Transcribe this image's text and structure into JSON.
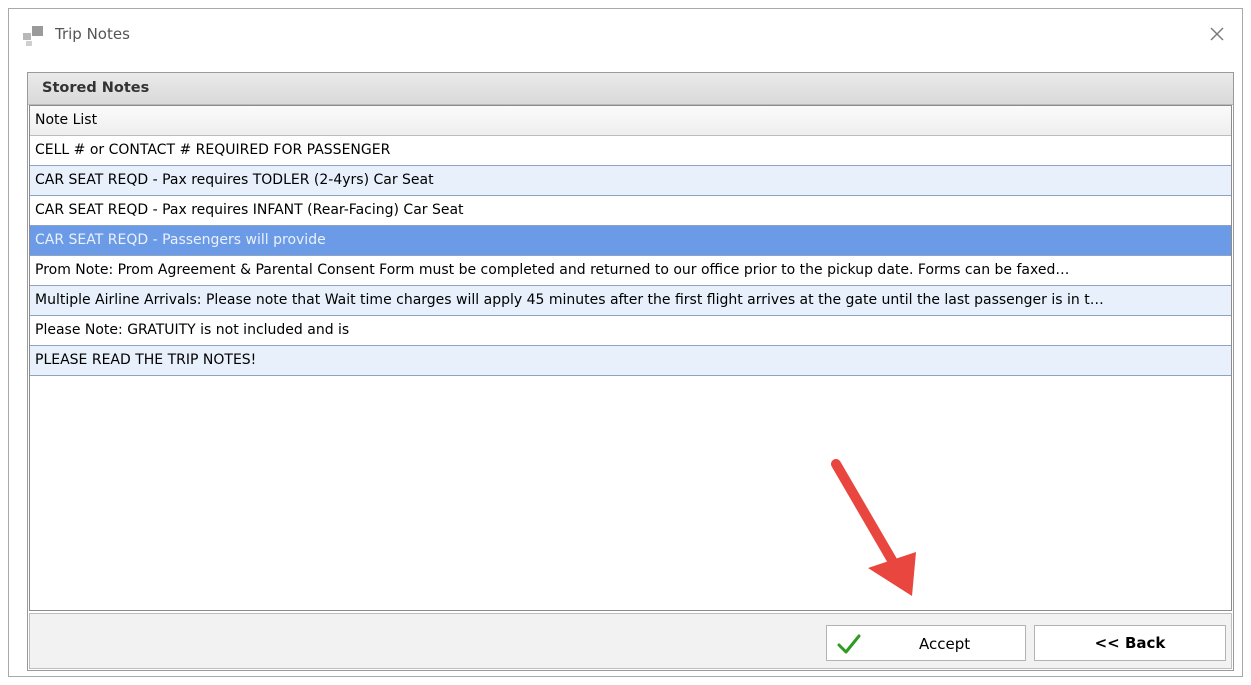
{
  "window": {
    "title": "Trip Notes"
  },
  "group": {
    "header": "Stored Notes"
  },
  "grid": {
    "column_header": "Note List",
    "rows": [
      "CELL # or CONTACT # REQUIRED FOR PASSENGER",
      "CAR SEAT REQD - Pax requires TODLER (2-4yrs) Car Seat",
      "CAR SEAT REQD - Pax requires INFANT (Rear-Facing) Car Seat",
      "CAR SEAT REQD - Passengers will provide",
      "Prom Note: Prom Agreement & Parental Consent Form must be completed and returned to our office prior to the pickup date.   Forms can be faxed…",
      "Multiple Airline Arrivals:  Please note that Wait time charges will apply 45 minutes after the first flight arrives at the gate until the last passenger is in t…",
      "Please Note:  GRATUITY is not included and is",
      "PLEASE READ THE TRIP NOTES!"
    ],
    "selected_index": 3
  },
  "buttons": {
    "accept_label": "Accept",
    "back_label": "<< Back"
  },
  "colors": {
    "selection": "#6b9ae6",
    "alt_row": "#e7f0fb",
    "check": "#2e9c1e",
    "arrow": "#e8463f"
  }
}
